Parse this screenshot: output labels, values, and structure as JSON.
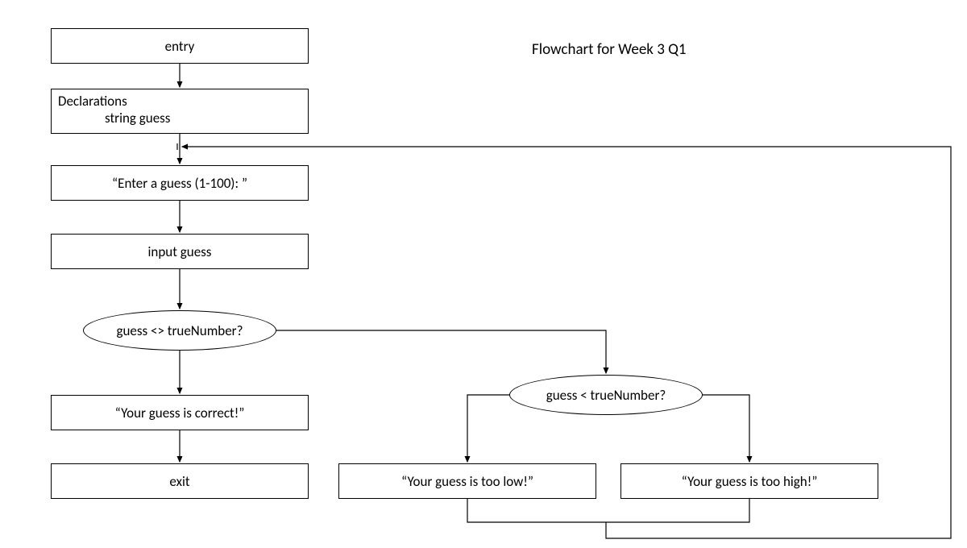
{
  "title": "Flowchart for Week 3 Q1",
  "nodes": {
    "entry": "entry",
    "declarations_header": "Declarations",
    "declarations_body": "string guess",
    "prompt": "“Enter a guess (1-100): ”",
    "input": "input guess",
    "decision1": "guess <> trueNumber?",
    "correct": "“Your guess is correct!”",
    "exit": "exit",
    "decision2": "guess < trueNumber?",
    "too_low": "“Your guess is too low!”",
    "too_high": "“Your guess is too high!”"
  }
}
